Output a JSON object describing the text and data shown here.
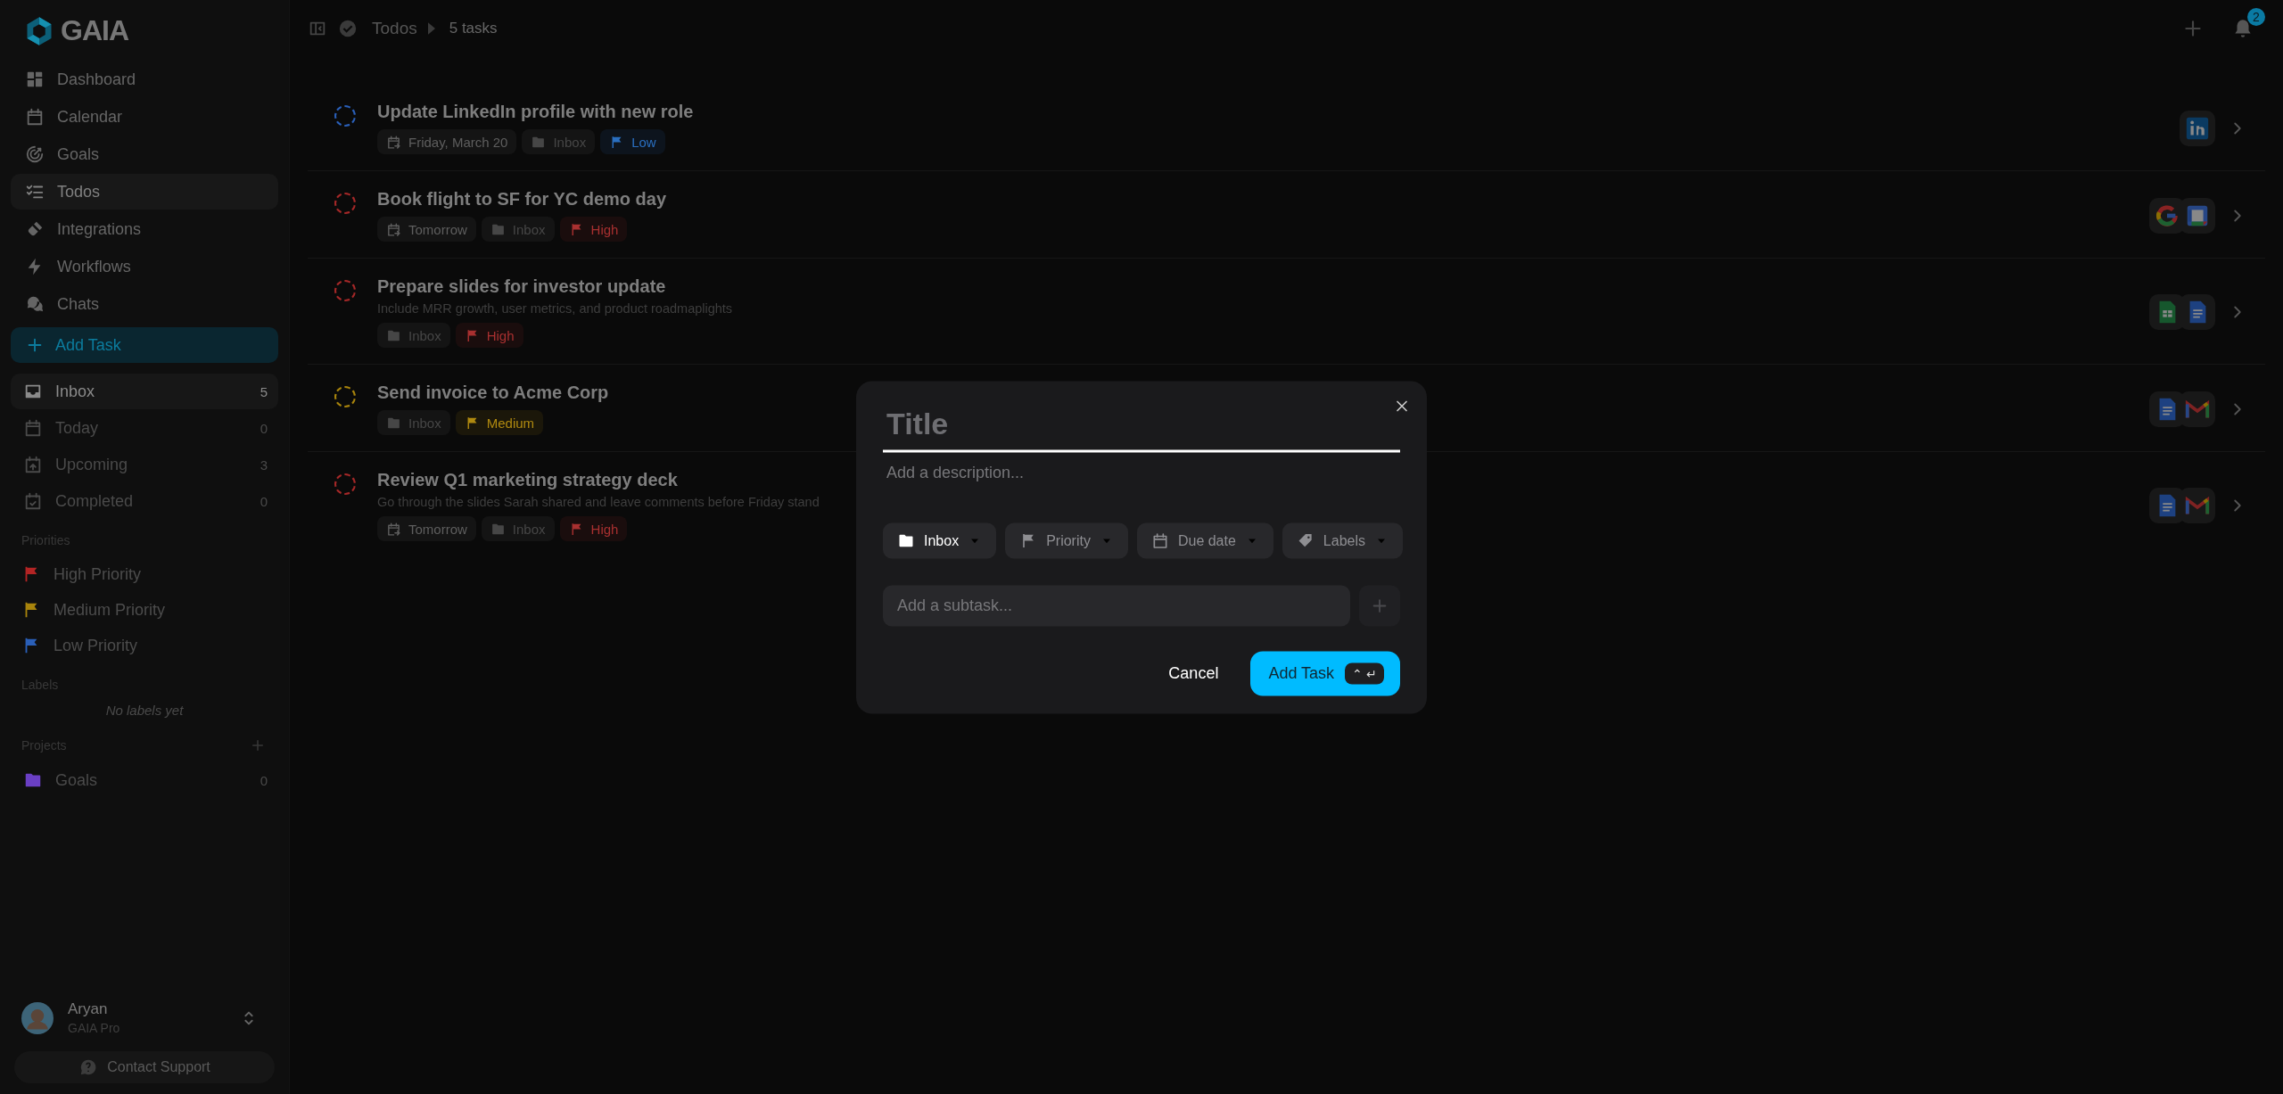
{
  "sidebar": {
    "brand": "GAIA",
    "nav": [
      {
        "label": "Dashboard",
        "selected": false
      },
      {
        "label": "Calendar",
        "selected": false
      },
      {
        "label": "Goals",
        "selected": false
      },
      {
        "label": "Todos",
        "selected": true
      },
      {
        "label": "Integrations",
        "selected": false
      },
      {
        "label": "Workflows",
        "selected": false
      },
      {
        "label": "Chats",
        "selected": false
      }
    ],
    "add_task": "Add Task",
    "views": [
      {
        "label": "Inbox",
        "count": "5",
        "selected": true
      },
      {
        "label": "Today",
        "count": "0",
        "selected": false
      },
      {
        "label": "Upcoming",
        "count": "3",
        "selected": false
      },
      {
        "label": "Completed",
        "count": "0",
        "selected": false
      }
    ],
    "priorities_heading": "Priorities",
    "priorities": [
      {
        "label": "High Priority",
        "color": "#b32424"
      },
      {
        "label": "Medium Priority",
        "color": "#a8840c"
      },
      {
        "label": "Low Priority",
        "color": "#2a5fb8"
      }
    ],
    "labels_heading": "Labels",
    "labels_empty": "No labels yet",
    "projects_heading": "Projects",
    "projects": [
      {
        "label": "Goals",
        "count": "0",
        "color": "#6a3fc4"
      }
    ],
    "user": {
      "name": "Aryan",
      "plan": "GAIA Pro"
    },
    "support": "Contact Support"
  },
  "header": {
    "breadcrumb": "Todos",
    "count": "5 tasks",
    "notifications": "2"
  },
  "tasks": [
    {
      "title": "Update LinkedIn profile with new role",
      "color": "#2a5fb8",
      "chips": [
        {
          "kind": "date",
          "label": "Friday, March 20"
        },
        {
          "kind": "project",
          "label": "Inbox"
        },
        {
          "kind": "priority",
          "label": "Low",
          "color": "#2a6fc0"
        }
      ],
      "apps": [
        {
          "kind": "linkedin"
        }
      ]
    },
    {
      "title": "Book flight to SF for YC demo day",
      "color": "#a52828",
      "chips": [
        {
          "kind": "date",
          "label": "Tomorrow"
        },
        {
          "kind": "project",
          "label": "Inbox"
        },
        {
          "kind": "priority",
          "label": "High",
          "color": "#a83030"
        }
      ],
      "apps": [
        {
          "kind": "google"
        },
        {
          "kind": "calendar"
        }
      ]
    },
    {
      "title": "Prepare slides for investor update",
      "description": "Include MRR growth, user metrics, and product roadmaplights",
      "color": "#a52828",
      "chips": [
        {
          "kind": "project",
          "label": "Inbox"
        },
        {
          "kind": "priority",
          "label": "High",
          "color": "#a83030"
        }
      ],
      "apps": [
        {
          "kind": "sheets"
        },
        {
          "kind": "docs"
        }
      ]
    },
    {
      "title": "Send invoice to Acme Corp",
      "color": "#a8840c",
      "chips": [
        {
          "kind": "project",
          "label": "Inbox"
        },
        {
          "kind": "priority",
          "label": "Medium",
          "color": "#b08a10"
        }
      ],
      "apps": [
        {
          "kind": "docs"
        },
        {
          "kind": "gmail"
        }
      ]
    },
    {
      "title": "Review Q1 marketing strategy deck",
      "description": "Go through the slides Sarah shared and leave comments before Friday stand",
      "color": "#a52828",
      "chips": [
        {
          "kind": "date",
          "label": "Tomorrow"
        },
        {
          "kind": "project",
          "label": "Inbox"
        },
        {
          "kind": "priority",
          "label": "High",
          "color": "#a83030"
        }
      ],
      "apps": [
        {
          "kind": "docs"
        },
        {
          "kind": "gmail"
        }
      ]
    }
  ],
  "modal": {
    "title_placeholder": "Title",
    "description_placeholder": "Add a description...",
    "chips": [
      {
        "kind": "project",
        "label": "Inbox",
        "active": true
      },
      {
        "kind": "priority",
        "label": "Priority",
        "active": false
      },
      {
        "kind": "date",
        "label": "Due date",
        "active": false
      },
      {
        "kind": "label",
        "label": "Labels",
        "active": false
      }
    ],
    "subtask_placeholder": "Add a subtask...",
    "cancel": "Cancel",
    "submit": "Add Task",
    "shortcut": [
      "⌃",
      "↵"
    ]
  }
}
